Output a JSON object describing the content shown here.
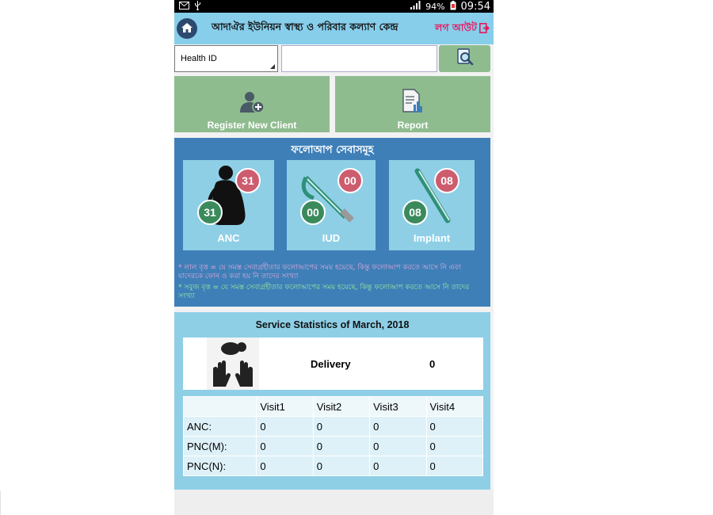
{
  "status_bar": {
    "battery": "94%",
    "time": "09:54"
  },
  "app_bar": {
    "title": "আদাঐর ইউনিয়ন স্বাস্থ্য ও পরিবার কল্যাণ কেন্দ্র",
    "logout_label": "লগ আউট"
  },
  "search": {
    "id_type_selected": "Health ID",
    "id_value": "",
    "button_icon": "search-document-icon"
  },
  "actions": {
    "register_label": "Register New Client",
    "report_label": "Report"
  },
  "followup": {
    "title": "ফলোআপ সেবাসমূহ",
    "cards": [
      {
        "label": "ANC",
        "red_count": "31",
        "green_count": "31",
        "icon": "pregnant-woman-icon"
      },
      {
        "label": "IUD",
        "red_count": "00",
        "green_count": "00",
        "icon": "iud-device-icon"
      },
      {
        "label": "Implant",
        "red_count": "08",
        "green_count": "08",
        "icon": "implant-rod-icon"
      }
    ],
    "note_red": "* লাল বৃত্ত = যে সমস্ত সেবাগ্রহীতার ফলোআপের সময় হয়েছে, কিন্তু ফলোআপ করতে আসে নি এবং যাদেরকে ফোন ও করা হয় নি তাদের সংখ্যা",
    "note_green": "* সবুজ বৃত্ত = যে সমস্ত সেবাগ্রহীতার ফলোআপের সময় হয়েছে, কিন্তু ফলোআপ করতে আসে নি তাদের সংখ্যা",
    "colors": {
      "red": "#cd5c6e",
      "green": "#3b8a5c",
      "note_red_text": "#d9a0c8",
      "note_green_text": "#9be89b"
    }
  },
  "stats": {
    "title": "Service Statistics of March, 2018",
    "delivery_label": "Delivery",
    "delivery_value": "0",
    "columns": [
      "",
      "Visit1",
      "Visit2",
      "Visit3",
      "Visit4"
    ],
    "rows": [
      {
        "label": "ANC:",
        "values": [
          "0",
          "0",
          "0",
          "0"
        ]
      },
      {
        "label": "PNC(M):",
        "values": [
          "0",
          "0",
          "0",
          "0"
        ]
      },
      {
        "label": "PNC(N):",
        "values": [
          "0",
          "0",
          "0",
          "0"
        ]
      }
    ]
  },
  "colors": {
    "app_bar": "#87ceeb",
    "action_button": "#8fbc8f",
    "followup_panel": "#3e7fb8",
    "card": "#8ecfe6",
    "logout": "#e8175d"
  }
}
